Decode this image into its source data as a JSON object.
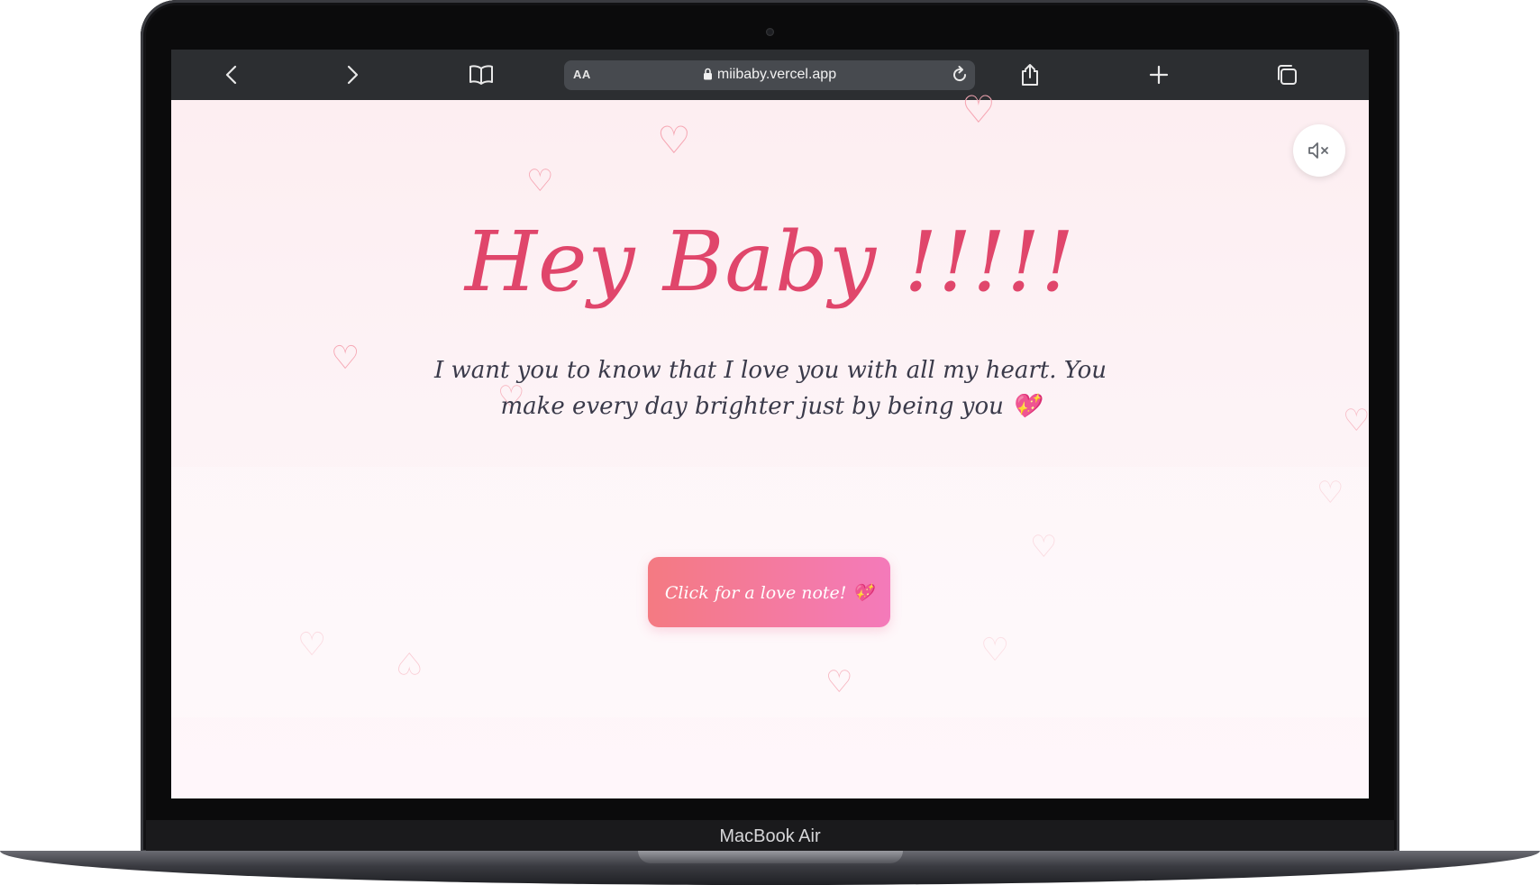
{
  "device": {
    "label": "MacBook Air"
  },
  "browser": {
    "aa_label": "AA",
    "url": "miibaby.vercel.app",
    "icons": [
      "chevron-left-icon",
      "chevron-right-icon",
      "book-icon",
      "lock-icon",
      "reload-icon",
      "share-icon",
      "plus-icon",
      "tabs-icon"
    ]
  },
  "page": {
    "title": "Hey Baby !!!!!",
    "message": "I want you to know that I love you with all my heart. You make every day brighter just by being you 💖",
    "love_button": "Click for a love note! 💖",
    "mute_icon": "speaker-muted-icon",
    "colors": {
      "accent": "#e0466b",
      "button_start": "#f47a82",
      "button_end": "#f47aba",
      "background": "#fdeef1"
    }
  }
}
